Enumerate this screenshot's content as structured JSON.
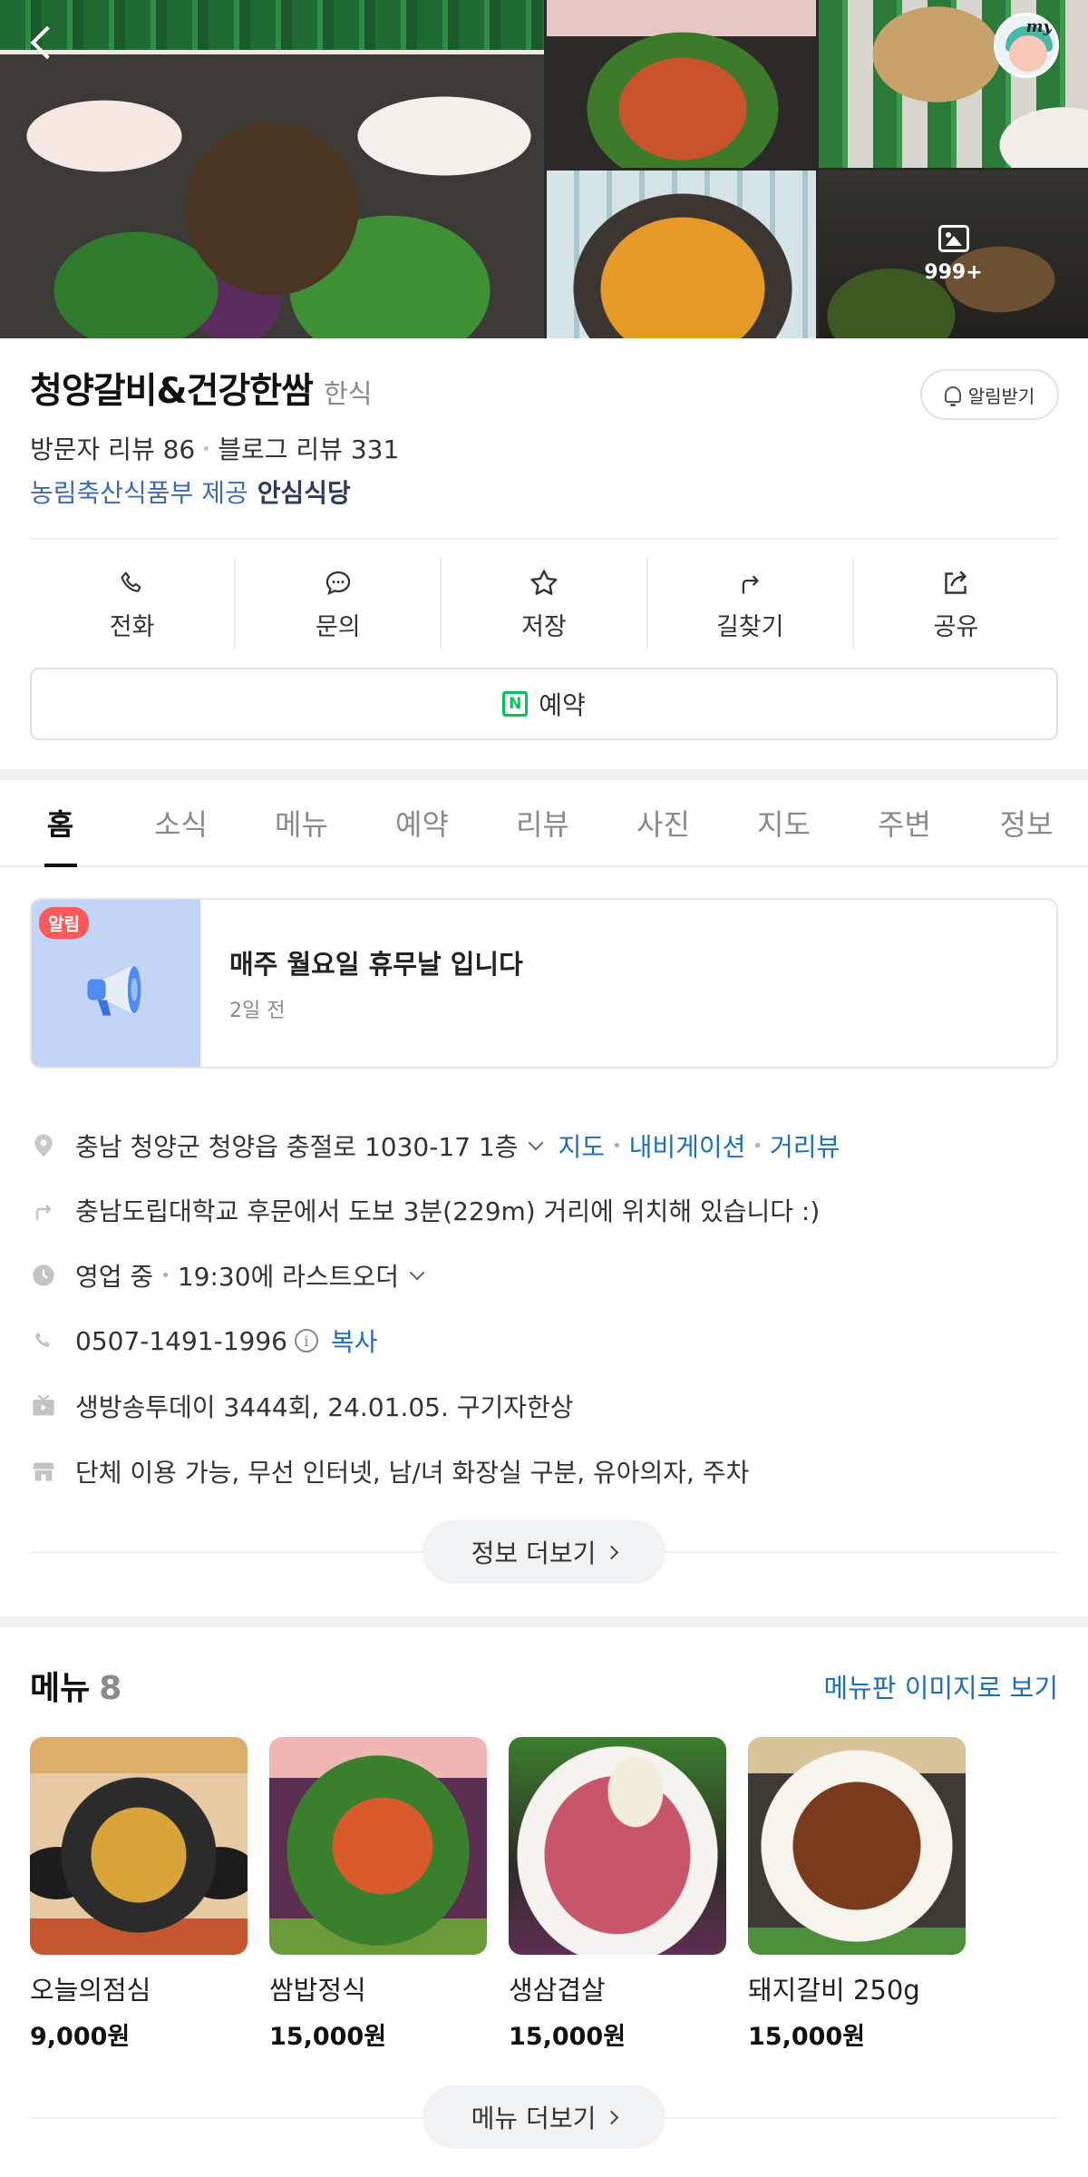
{
  "gallery": {
    "more_count": "999+"
  },
  "place": {
    "name": "청양갈비&건강한쌈",
    "category": "한식",
    "alarm_label": "알림받기",
    "visitor_reviews": "방문자 리뷰 86",
    "blog_reviews": "블로그 리뷰 331",
    "provider": "농림축산식품부 제공",
    "safe_label": "안심식당"
  },
  "actions": [
    {
      "label": "전화",
      "icon": "phone-icon"
    },
    {
      "label": "문의",
      "icon": "chat-icon"
    },
    {
      "label": "저장",
      "icon": "star-icon"
    },
    {
      "label": "길찾기",
      "icon": "directions-icon"
    },
    {
      "label": "공유",
      "icon": "share-icon"
    }
  ],
  "reserve_label": "예약",
  "tabs": [
    "홈",
    "소식",
    "메뉴",
    "예약",
    "리뷰",
    "사진",
    "지도",
    "주변",
    "정보"
  ],
  "notice": {
    "badge": "알림",
    "title": "매주 월요일 휴무날 입니다",
    "time": "2일 전"
  },
  "info": {
    "address": "충남 청양군 청양읍 충절로 1030-17 1층",
    "map_link": "지도",
    "nav_link": "내비게이션",
    "street_link": "거리뷰",
    "directions_text": "충남도립대학교 후문에서 도보 3분(229m) 거리에 위치해 있습니다 :)",
    "hours_status": "영업 중",
    "hours_detail": "19:30에 라스트오더",
    "phone": "0507-1491-1996",
    "info_symbol": "i",
    "copy_label": "복사",
    "tv": "생방송투데이 3444회, 24.01.05. 구기자한상",
    "facilities": "단체 이용 가능, 무선 인터넷, 남/녀 화장실 구분, 유아의자, 주차",
    "more_label": "정보 더보기"
  },
  "menu": {
    "title": "메뉴",
    "count": "8",
    "board_link": "메뉴판 이미지로 보기",
    "items": [
      {
        "name": "오늘의점심",
        "price": "9,000원"
      },
      {
        "name": "쌈밥정식",
        "price": "15,000원"
      },
      {
        "name": "생삼겹살",
        "price": "15,000원"
      },
      {
        "name": "돼지갈비 250g",
        "price": "15,000원"
      }
    ],
    "more_label": "메뉴 더보기"
  },
  "colors": {
    "link": "#1e6fb8",
    "naver_green": "#03c75a",
    "badge_red": "#ff5a5a"
  }
}
